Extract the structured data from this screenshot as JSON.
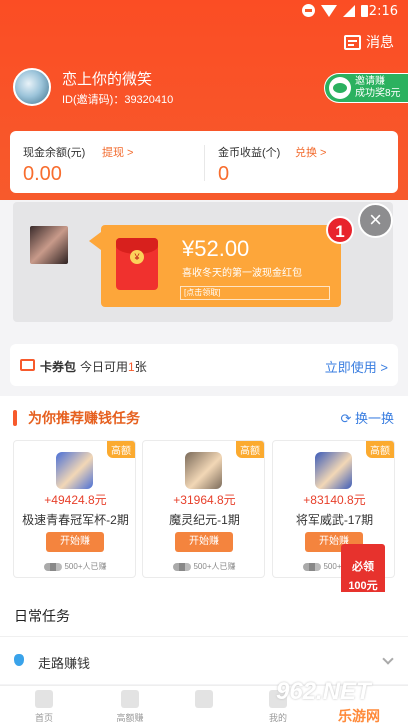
{
  "status": {
    "time": "2:16"
  },
  "header": {
    "message_label": "消息",
    "username": "恋上你的微笑",
    "user_id": "ID(邀请码)：39320410",
    "invite": {
      "line1": "邀请赚",
      "line2": "成功奖8元"
    }
  },
  "balance": {
    "cash": {
      "label": "现金余额(元)",
      "action": "提现 >",
      "value": "0.00"
    },
    "gold": {
      "label": "金币收益(个)",
      "action": "兑换 >",
      "value": "0"
    }
  },
  "redpacket": {
    "amount": "¥52.00",
    "desc": "喜收冬天的第一波现金红包",
    "cta": "[点击领取]",
    "badge": "1",
    "close": "×",
    "coin_glyph": "¥"
  },
  "coupon": {
    "title": "卡券包",
    "today_prefix": "今日可用",
    "today_count": "1",
    "today_suffix": "张",
    "use_now": "立即使用 >"
  },
  "tasks": {
    "title": "为你推荐赚钱任务",
    "refresh": "⟳ 换一换",
    "items": [
      {
        "tag": "高额",
        "amount": "+49424.8元",
        "name": "极速青春冠军杯-2期",
        "button": "开始赚",
        "joined": "500+人已赚",
        "color": "#4a6fd6"
      },
      {
        "tag": "高额",
        "amount": "+31964.8元",
        "name": "魔灵纪元-1期",
        "button": "开始赚",
        "joined": "500+人已赚",
        "color": "#7a6a5a"
      },
      {
        "tag": "高额",
        "amount": "+83140.8元",
        "name": "将军威武-17期",
        "button": "开始赚",
        "joined": "500+人已赚",
        "color": "#3b5bb8"
      }
    ]
  },
  "must_get": {
    "top": "必领",
    "amount": "100元"
  },
  "daily": {
    "title": "日常任务",
    "walk": "走路赚钱"
  },
  "tabbar": [
    "首页",
    "高额赚",
    "",
    "我的"
  ],
  "watermark": {
    "logo": "962.NET",
    "site": "乐游网"
  },
  "colors": {
    "brand": "#f75a2c",
    "link": "#3a7ee0",
    "money": "#f86d2e"
  }
}
